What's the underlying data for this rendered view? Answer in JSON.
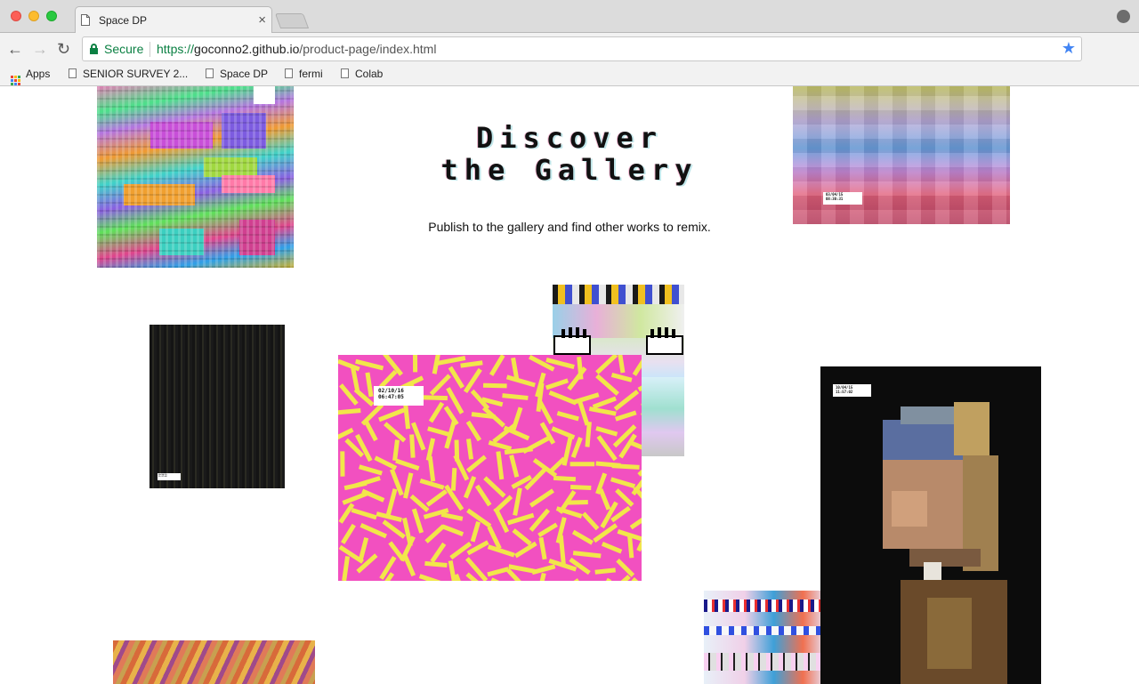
{
  "browser": {
    "tab_title": "Space DP",
    "tab_close": "×",
    "secure_label": "Secure",
    "url_scheme": "https://",
    "url_host": "goconno2.github.io",
    "url_path": "/product-page/index.html",
    "back_glyph": "←",
    "forward_glyph": "→",
    "reload_glyph": "↻",
    "star_glyph": "★",
    "bookmarks": {
      "apps": "Apps",
      "items": [
        "SENIOR SURVEY 2...",
        "Space DP",
        "fermi",
        "Colab"
      ]
    }
  },
  "page": {
    "heading_line1": "Discover",
    "heading_line2": "the Gallery",
    "subtitle": "Publish to the gallery and find other works to remix.",
    "stamps": {
      "sky": [
        "03/04/15",
        "08:30:31"
      ],
      "dark": [
        "10/04/15",
        "11:57:02"
      ],
      "memphis": [
        "02/10/16",
        "06:47:05"
      ],
      "portrait": [
        "10/04/15",
        "11:57:02"
      ]
    }
  },
  "colors": {
    "secure_green": "#0b8043",
    "star_blue": "#4285f4",
    "memphis_pink": "#f250c0",
    "memphis_yellow": "#f2e64a"
  },
  "icons": [
    "document-icon",
    "lock-icon",
    "star-icon",
    "apps-icon",
    "profile-icon",
    "extension-icon",
    "menu-icon",
    "back-icon",
    "forward-icon",
    "reload-icon",
    "close-icon"
  ]
}
